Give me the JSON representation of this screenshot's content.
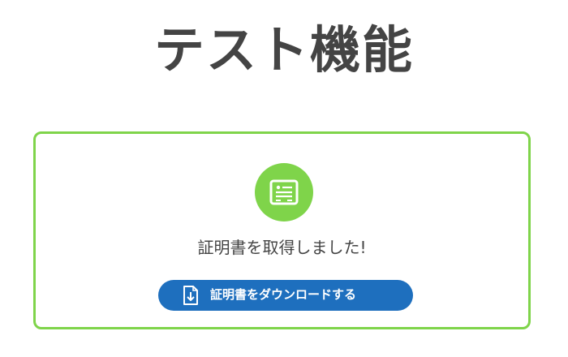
{
  "page": {
    "title": "テスト機能"
  },
  "result_card": {
    "icon": "certificate-icon",
    "message": "証明書を取得しました!",
    "download_button": {
      "label": "証明書をダウンロードする",
      "icon": "file-download-icon"
    }
  },
  "colors": {
    "accent_green": "#7fd44a",
    "button_blue": "#1e6fbe",
    "text_dark": "#444444"
  }
}
